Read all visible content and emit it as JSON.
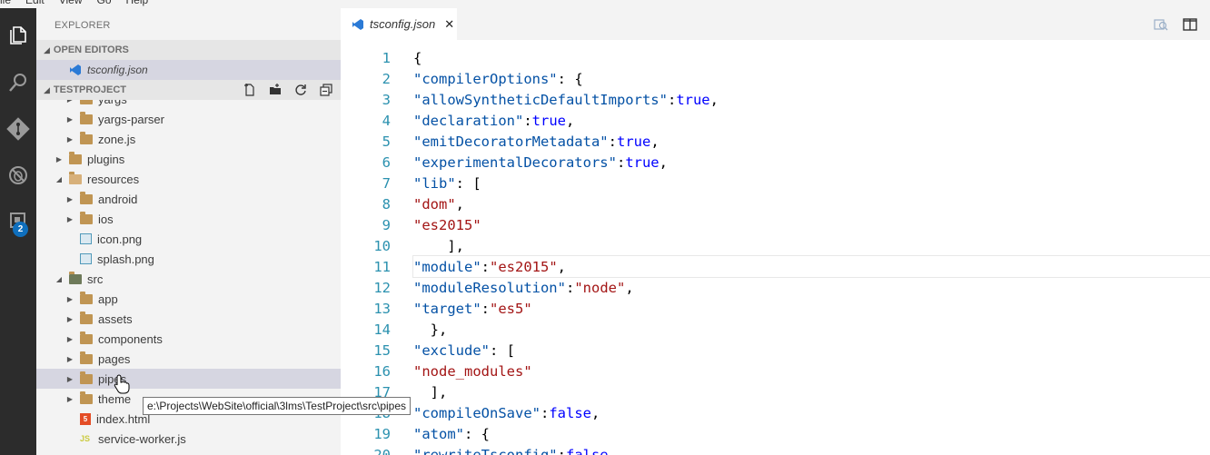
{
  "menu": [
    "ile",
    "Edit",
    "View",
    "Go",
    "Help"
  ],
  "activity": {
    "badge": "2"
  },
  "sidebar": {
    "title": "EXPLORER",
    "open_editors_label": "OPEN EDITORS",
    "open_editor_file": "tsconfig.json",
    "project_label": "TESTPROJECT",
    "tree": [
      {
        "label": "yargs",
        "kind": "folder",
        "depth": 1
      },
      {
        "label": "yargs-parser",
        "kind": "folder",
        "depth": 1
      },
      {
        "label": "zone.js",
        "kind": "folder",
        "depth": 1
      },
      {
        "label": "plugins",
        "kind": "folder",
        "depth": 0
      },
      {
        "label": "resources",
        "kind": "folder-open",
        "depth": 0
      },
      {
        "label": "android",
        "kind": "folder",
        "depth": 1
      },
      {
        "label": "ios",
        "kind": "folder",
        "depth": 1
      },
      {
        "label": "icon.png",
        "kind": "image",
        "depth": 1
      },
      {
        "label": "splash.png",
        "kind": "image",
        "depth": 1
      },
      {
        "label": "src",
        "kind": "folder-src",
        "depth": 0
      },
      {
        "label": "app",
        "kind": "folder",
        "depth": 1
      },
      {
        "label": "assets",
        "kind": "folder",
        "depth": 1
      },
      {
        "label": "components",
        "kind": "folder",
        "depth": 1
      },
      {
        "label": "pages",
        "kind": "folder",
        "depth": 1
      },
      {
        "label": "pipes",
        "kind": "folder",
        "depth": 1,
        "selected": true
      },
      {
        "label": "theme",
        "kind": "folder",
        "depth": 1
      },
      {
        "label": "index.html",
        "kind": "html",
        "depth": 1
      },
      {
        "label": "service-worker.js",
        "kind": "js",
        "depth": 1
      }
    ],
    "tooltip": "e:\\Projects\\WebSite\\official\\3lms\\TestProject\\src\\pipes"
  },
  "editor": {
    "tab_label": "tsconfig.json",
    "tab_close": "✕",
    "current_line": 11,
    "lines": [
      "{",
      "  \"compilerOptions\": {",
      "    \"allowSyntheticDefaultImports\": true,",
      "    \"declaration\": true,",
      "    \"emitDecoratorMetadata\": true,",
      "    \"experimentalDecorators\": true,",
      "    \"lib\": [",
      "      \"dom\",",
      "      \"es2015\"",
      "    ],",
      "    \"module\": \"es2015\",",
      "    \"moduleResolution\": \"node\",",
      "    \"target\": \"es5\"",
      "  },",
      "  \"exclude\": [",
      "    \"node_modules\"",
      "  ],",
      "  \"compileOnSave\": false,",
      "  \"atom\": {",
      "    \"rewriteTsconfig\": false"
    ]
  },
  "colors": {
    "activity_bar": "#2c2c2c",
    "sidebar": "#f3f3f3",
    "selection": "#d6d6e1",
    "line_number": "#2b91af",
    "json_key": "#a31515",
    "json_string": "#a31515",
    "json_bool": "#0000ff",
    "badge": "#0f6fbd"
  }
}
